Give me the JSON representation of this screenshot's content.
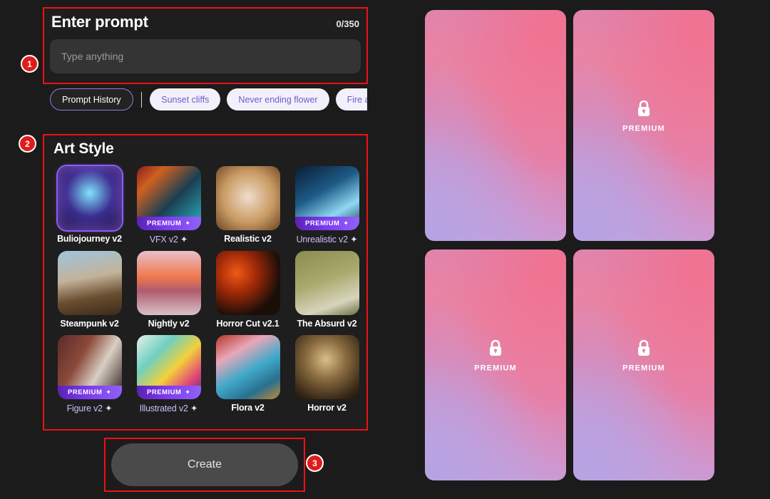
{
  "prompt_section": {
    "title": "Enter prompt",
    "counter": "0/350",
    "input_value": "",
    "input_placeholder": "Type anything"
  },
  "chips": {
    "history_label": "Prompt History",
    "suggestions": [
      {
        "label": "Sunset cliffs"
      },
      {
        "label": "Never ending flower"
      },
      {
        "label": "Fire and w"
      }
    ]
  },
  "art_style": {
    "title": "Art Style",
    "premium_badge_label": "PREMIUM",
    "sparkle_glyph": "✦",
    "styles": [
      {
        "label": "Buliojourney v2",
        "premium": false,
        "selected": true,
        "sparkle": false
      },
      {
        "label": "VFX v2",
        "premium": true,
        "selected": false,
        "sparkle": true
      },
      {
        "label": "Realistic v2",
        "premium": false,
        "selected": false,
        "sparkle": false
      },
      {
        "label": "Unrealistic v2",
        "premium": true,
        "selected": false,
        "sparkle": true
      },
      {
        "label": "Steampunk v2",
        "premium": false,
        "selected": false,
        "sparkle": false
      },
      {
        "label": "Nightly v2",
        "premium": false,
        "selected": false,
        "sparkle": false
      },
      {
        "label": "Horror Cut v2.1",
        "premium": false,
        "selected": false,
        "sparkle": false
      },
      {
        "label": "The Absurd v2",
        "premium": false,
        "selected": false,
        "sparkle": false
      },
      {
        "label": "Figure v2",
        "premium": true,
        "selected": false,
        "sparkle": true
      },
      {
        "label": "Illustrated v2",
        "premium": true,
        "selected": false,
        "sparkle": true
      },
      {
        "label": "Flora v2",
        "premium": false,
        "selected": false,
        "sparkle": false
      },
      {
        "label": "Horror v2",
        "premium": false,
        "selected": false,
        "sparkle": false
      }
    ]
  },
  "create": {
    "label": "Create"
  },
  "annotations": {
    "badge_1": "1",
    "badge_2": "2",
    "badge_3": "3",
    "color": "#e01b1b"
  },
  "results": {
    "premium_label": "PREMIUM",
    "cards": [
      {
        "locked": false
      },
      {
        "locked": true
      },
      {
        "locked": true
      },
      {
        "locked": true
      }
    ]
  },
  "colors": {
    "background": "#1b1b1b",
    "panel": "#1e1e1e",
    "input": "#343434",
    "accent_purple": "#8b5cf6",
    "premium_gradient_start": "#5b21b6",
    "premium_gradient_end": "#9061f9",
    "annotation_red": "#ee1111",
    "create_button": "#4a4a4a",
    "card_gradient_pink": "#e884a4",
    "card_gradient_lavender": "#bda6e3"
  }
}
